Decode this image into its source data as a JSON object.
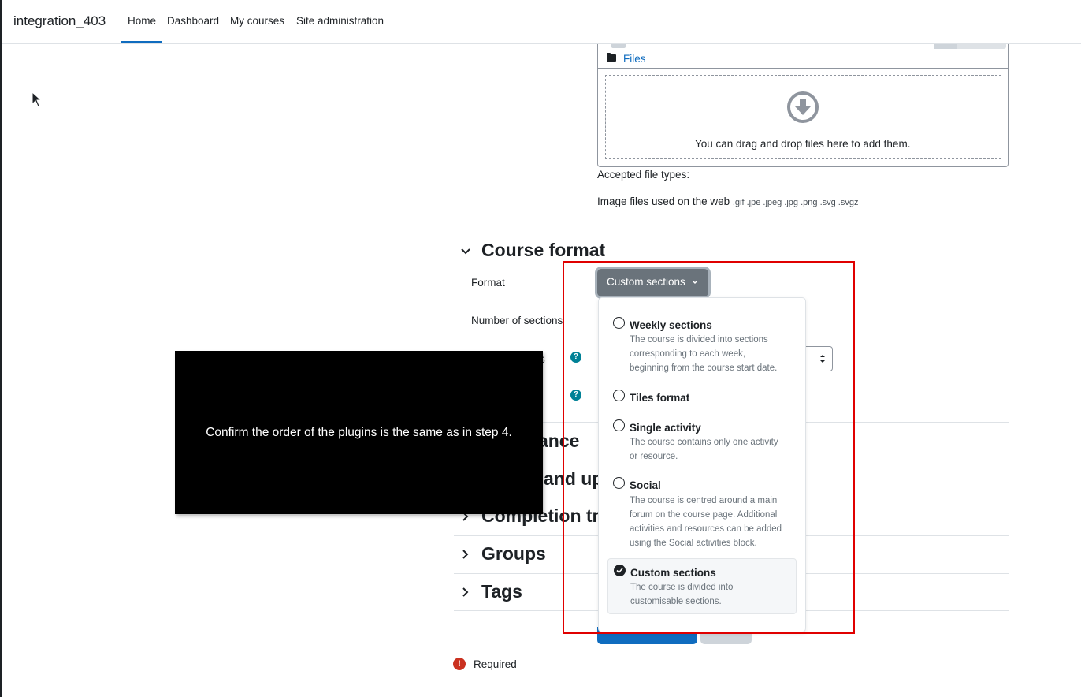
{
  "navbar": {
    "brand": "integration_403",
    "items": [
      "Home",
      "Dashboard",
      "My courses",
      "Site administration"
    ]
  },
  "filemanager": {
    "folder_label": "Files",
    "drop_text": "You can drag and drop files here to add them.",
    "accepted_label": "Accepted file types:",
    "accepted_desc": "Image files used on the web",
    "accepted_ext": ".gif .jpe .jpeg .jpg .png .svg .svgz"
  },
  "course_format": {
    "section_title": "Course format",
    "format_label": "Format",
    "format_value": "Custom sections",
    "num_sections_label": "Number of sections",
    "partial_label": "s"
  },
  "dropdown": {
    "options": [
      {
        "title": "Weekly sections",
        "desc": [
          "The course is divided into sections",
          "corresponding to each week,",
          "beginning from the course start date."
        ],
        "selected": false
      },
      {
        "title": "Tiles format",
        "desc": [],
        "selected": false
      },
      {
        "title": "Single activity",
        "desc": [
          "The course contains only one activity",
          "or resource."
        ],
        "selected": false
      },
      {
        "title": "Social",
        "desc": [
          "The course is centred around a main",
          "forum on the course page. Additional",
          "activities and resources can be added",
          "using the Social activities block."
        ],
        "selected": false
      },
      {
        "title": "Custom sections",
        "desc": [
          "The course is divided into",
          "customisable sections."
        ],
        "selected": true
      }
    ]
  },
  "sections": {
    "appearance_partial": "rance",
    "files_partial": "and uplo",
    "completion_partial": "Completion tr",
    "groups": "Groups",
    "tags": "Tags"
  },
  "required_label": "Required",
  "overlay": {
    "text": "Confirm the order of the plugins is the same as in step 4."
  },
  "colors": {
    "link": "#0f6cbf",
    "help": "#008196",
    "required": "#ca3120",
    "highlight": "#e00000"
  }
}
